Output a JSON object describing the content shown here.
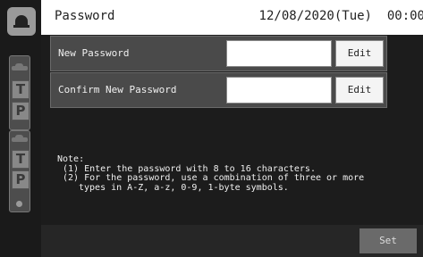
{
  "header": {
    "title": "Password",
    "datetime": "12/08/2020(Tue)",
    "time": "00:00"
  },
  "rows": [
    {
      "label": "New Password",
      "value": "",
      "button": "Edit"
    },
    {
      "label": "Confirm New Password",
      "value": "",
      "button": "Edit"
    }
  ],
  "note": {
    "heading": "Note:",
    "line1": "(1) Enter the password with 8 to 16 characters.",
    "line2": "(2) For the password, use a combination of three or more",
    "line3": "types in A-Z, a-z, 0-9, 1-byte symbols."
  },
  "footer": {
    "set_label": "Set"
  },
  "side_status": {
    "icons": [
      "bell-icon",
      "car-icon",
      "T",
      "P",
      "car-icon",
      "T",
      "P",
      "dot-icon"
    ]
  }
}
